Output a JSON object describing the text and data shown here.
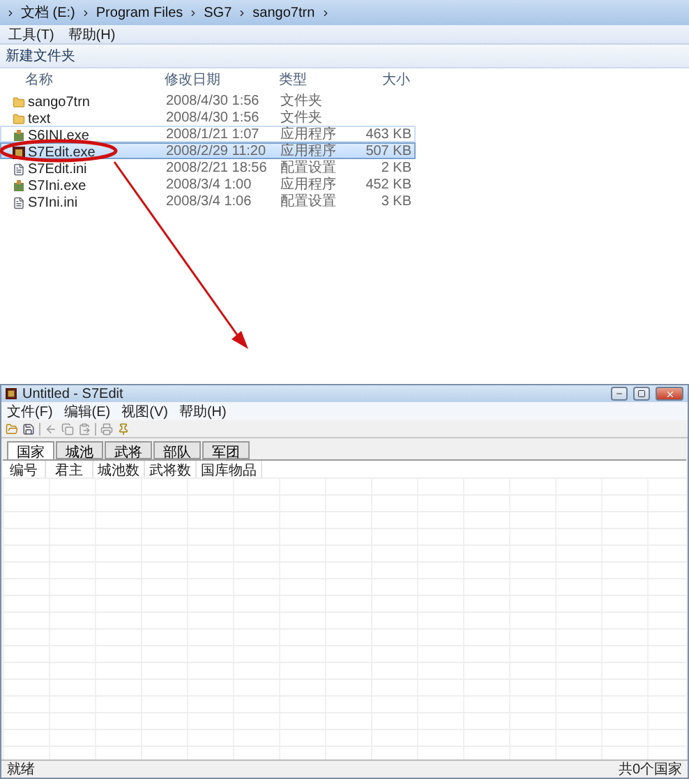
{
  "explorer": {
    "address_path": [
      "文档 (E:)",
      "Program Files",
      "SG7",
      "sango7trn"
    ],
    "menu": [
      "工具(T)",
      "帮助(H)"
    ],
    "toolbar_button": "新建文件夹",
    "columns": [
      "名称",
      "修改日期",
      "类型",
      "大小"
    ],
    "files": [
      {
        "kind": "folder",
        "name": "sango7trn",
        "modified": "2008/4/30 1:56",
        "type": "文件夹",
        "selected": false,
        "hovered": false
      },
      {
        "kind": "folder",
        "name": "text",
        "modified": "2008/4/30 1:56",
        "type": "文件夹",
        "selected": false,
        "hovered": false
      },
      {
        "kind": "exe",
        "name": "S6INI.exe",
        "modified": "2008/1/21 1:07",
        "type": "应用程序",
        "size": "463 KB",
        "selected": false,
        "hovered": true
      },
      {
        "kind": "app",
        "name": "S7Edit.exe",
        "modified": "2008/2/29 11:20",
        "type": "应用程序",
        "size": "507 KB",
        "selected": true,
        "hovered": false
      },
      {
        "kind": "ini",
        "name": "S7Edit.ini",
        "modified": "2008/2/21 18:56",
        "type": "配置设置",
        "size": "2 KB",
        "selected": false,
        "hovered": false
      },
      {
        "kind": "exe",
        "name": "S7Ini.exe",
        "modified": "2008/3/4 1:00",
        "type": "应用程序",
        "size": "452 KB",
        "selected": false,
        "hovered": false
      },
      {
        "kind": "ini",
        "name": "S7Ini.ini",
        "modified": "2008/3/4 1:06",
        "type": "配置设置",
        "size": "3 KB",
        "selected": false,
        "hovered": false
      }
    ]
  },
  "editor": {
    "title": "Untitled - S7Edit",
    "menu": [
      "文件(F)",
      "编辑(E)",
      "视图(V)",
      "帮助(H)"
    ],
    "tabs": [
      {
        "label": "国家",
        "selected": true
      },
      {
        "label": "城池",
        "selected": false
      },
      {
        "label": "武将",
        "selected": false
      },
      {
        "label": "部队",
        "selected": false
      },
      {
        "label": "军团",
        "selected": false
      }
    ],
    "columns": [
      "编号",
      "君主",
      "城池数",
      "武将数",
      "国库物品"
    ],
    "status_left": "就绪",
    "status_right": "共0个国家"
  }
}
